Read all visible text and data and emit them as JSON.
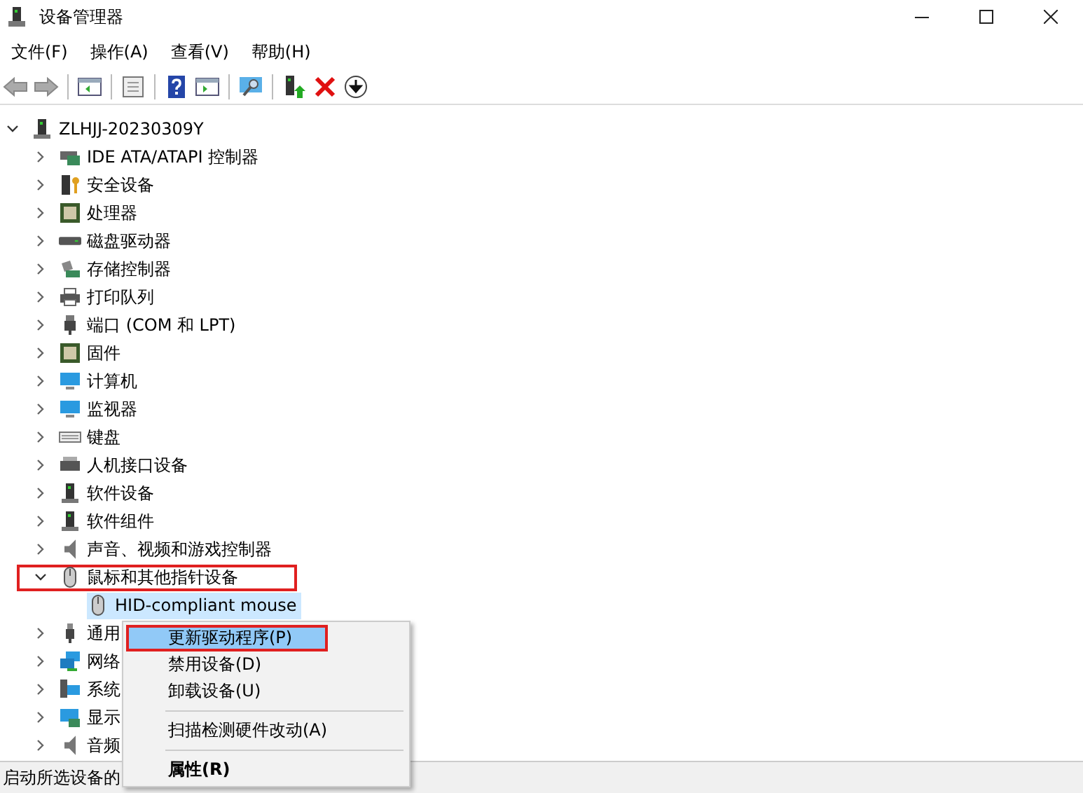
{
  "window": {
    "title": "设备管理器"
  },
  "menu_bar": [
    "文件(F)",
    "操作(A)",
    "查看(V)",
    "帮助(H)"
  ],
  "tree": {
    "label": "ZLHJJ-20230309Y",
    "expanded": true,
    "selected": false,
    "highlighted": false,
    "children": [
      {
        "label": "IDE ATA/ATAPI 控制器",
        "expanded": false,
        "selected": false,
        "highlighted": false
      },
      {
        "label": "安全设备",
        "expanded": false,
        "selected": false,
        "highlighted": false
      },
      {
        "label": "处理器",
        "expanded": false,
        "selected": false,
        "highlighted": false
      },
      {
        "label": "磁盘驱动器",
        "expanded": false,
        "selected": false,
        "highlighted": false
      },
      {
        "label": "存储控制器",
        "expanded": false,
        "selected": false,
        "highlighted": false
      },
      {
        "label": "打印队列",
        "expanded": false,
        "selected": false,
        "highlighted": false
      },
      {
        "label": "端口 (COM 和 LPT)",
        "expanded": false,
        "selected": false,
        "highlighted": false
      },
      {
        "label": "固件",
        "expanded": false,
        "selected": false,
        "highlighted": false
      },
      {
        "label": "计算机",
        "expanded": false,
        "selected": false,
        "highlighted": false
      },
      {
        "label": "监视器",
        "expanded": false,
        "selected": false,
        "highlighted": false
      },
      {
        "label": "键盘",
        "expanded": false,
        "selected": false,
        "highlighted": false
      },
      {
        "label": "人机接口设备",
        "expanded": false,
        "selected": false,
        "highlighted": false
      },
      {
        "label": "软件设备",
        "expanded": false,
        "selected": false,
        "highlighted": false
      },
      {
        "label": "软件组件",
        "expanded": false,
        "selected": false,
        "highlighted": false
      },
      {
        "label": "声音、视频和游戏控制器",
        "expanded": false,
        "selected": false,
        "highlighted": false
      },
      {
        "label": "鼠标和其他指针设备",
        "expanded": true,
        "selected": false,
        "highlighted": true,
        "children": [
          {
            "label": "HID-compliant mouse",
            "selected": true,
            "highlighted": false
          }
        ]
      },
      {
        "label": "通用",
        "expanded": false,
        "selected": false,
        "highlighted": false
      },
      {
        "label": "网络",
        "expanded": false,
        "selected": false,
        "highlighted": false
      },
      {
        "label": "系统",
        "expanded": false,
        "selected": false,
        "highlighted": false
      },
      {
        "label": "显示",
        "expanded": false,
        "selected": false,
        "highlighted": false
      },
      {
        "label": "音频",
        "expanded": false,
        "selected": false,
        "highlighted": false
      }
    ]
  },
  "context_menu": [
    {
      "kind": "command",
      "label": "更新驱动程序(P)",
      "selected": true,
      "highlighted": true,
      "default": false
    },
    {
      "kind": "command",
      "label": "禁用设备(D)",
      "selected": false,
      "highlighted": false,
      "default": false
    },
    {
      "kind": "command",
      "label": "卸载设备(U)",
      "selected": false,
      "highlighted": false,
      "default": false
    },
    {
      "kind": "separator"
    },
    {
      "kind": "command",
      "label": "扫描检测硬件改动(A)",
      "selected": false,
      "highlighted": false,
      "default": false
    },
    {
      "kind": "separator"
    },
    {
      "kind": "command",
      "label": "属性(R)",
      "selected": false,
      "highlighted": false,
      "default": true
    }
  ],
  "status_bar": {
    "text": "启动所选设备的"
  }
}
